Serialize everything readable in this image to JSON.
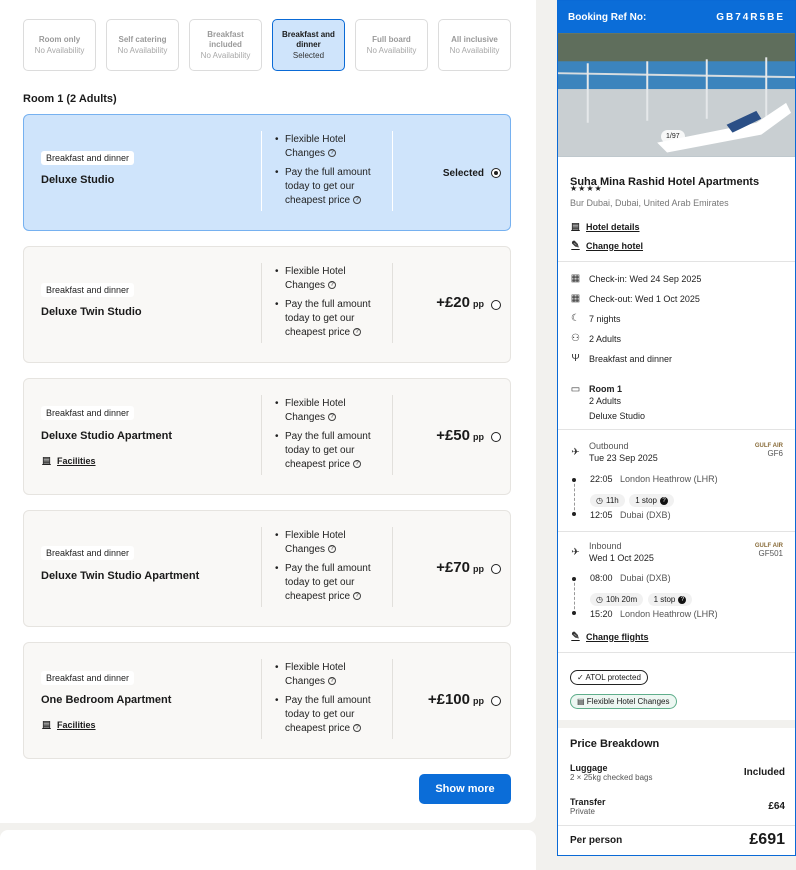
{
  "boards": [
    {
      "title": "Room only",
      "status": "No Availability",
      "selected": false
    },
    {
      "title": "Self catering",
      "status": "No Availability",
      "selected": false
    },
    {
      "title": "Breakfast included",
      "status": "No Availability",
      "selected": false
    },
    {
      "title": "Breakfast and dinner",
      "status": "Selected",
      "selected": true
    },
    {
      "title": "Full board",
      "status": "No Availability",
      "selected": false
    },
    {
      "title": "All inclusive",
      "status": "No Availability",
      "selected": false
    }
  ],
  "room_title": "Room 1 (2 Adults)",
  "rooms": [
    {
      "tag": "Breakfast and dinner",
      "name": "Deluxe Studio",
      "facilities": "",
      "price": "",
      "pp": "",
      "selected_label": "Selected",
      "bullet1": "Flexible Hotel Changes",
      "bullet2": "Pay the full amount today to get our cheapest price"
    },
    {
      "tag": "Breakfast and dinner",
      "name": "Deluxe Twin Studio",
      "facilities": "",
      "price": "+£20",
      "pp": "pp",
      "bullet1": "Flexible Hotel Changes",
      "bullet2": "Pay the full amount today to get our cheapest price"
    },
    {
      "tag": "Breakfast and dinner",
      "name": "Deluxe Studio Apartment",
      "facilities": "Facilities",
      "price": "+£50",
      "pp": "pp",
      "bullet1": "Flexible Hotel Changes",
      "bullet2": "Pay the full amount today to get our cheapest price"
    },
    {
      "tag": "Breakfast and dinner",
      "name": "Deluxe Twin Studio Apartment",
      "facilities": "",
      "price": "+£70",
      "pp": "pp",
      "bullet1": "Flexible Hotel Changes",
      "bullet2": "Pay the full amount today to get our cheapest price"
    },
    {
      "tag": "Breakfast and dinner",
      "name": "One Bedroom Apartment",
      "facilities": "Facilities",
      "price": "+£100",
      "pp": "pp",
      "bullet1": "Flexible Hotel Changes",
      "bullet2": "Pay the full amount today to get our cheapest price"
    }
  ],
  "show_more": "Show more",
  "booking": {
    "ref_label": "Booking Ref No:",
    "ref": "GB74R5BE",
    "image_count": "1/97",
    "hotel_name": "Suha Mina Rashid Hotel Apartments",
    "stars": "★★★★",
    "location": "Bur Dubai, Dubai, United Arab Emirates",
    "hotel_details": "Hotel details",
    "change_hotel": "Change hotel",
    "checkin": "Check-in: Wed 24 Sep 2025",
    "checkout": "Check-out: Wed 1 Oct 2025",
    "nights": "7 nights",
    "adults": "2 Adults",
    "board": "Breakfast and dinner",
    "room_label": "Room 1",
    "room_adults": "2 Adults",
    "room_name": "Deluxe Studio",
    "outbound": {
      "label": "Outbound",
      "date": "Tue 23 Sep 2025",
      "airline": "GULF AIR",
      "code": "GF6",
      "dep_time": "22:05",
      "dep_airport": "London Heathrow (LHR)",
      "duration": "11h",
      "stops": "1 stop",
      "arr_time": "12:05",
      "arr_airport": "Dubai (DXB)"
    },
    "inbound": {
      "label": "Inbound",
      "date": "Wed 1 Oct 2025",
      "airline": "GULF AIR",
      "code": "GF501",
      "dep_time": "08:00",
      "dep_airport": "Dubai (DXB)",
      "duration": "10h 20m",
      "stops": "1 stop",
      "arr_time": "15:20",
      "arr_airport": "London Heathrow (LHR)"
    },
    "change_flights": "Change flights",
    "atol": "ATOL protected",
    "flex": "Flexible Hotel Changes",
    "price_breakdown": "Price Breakdown",
    "luggage_label": "Luggage",
    "luggage_desc": "2 × 25kg checked bags",
    "luggage_value": "Included",
    "transfer_label": "Transfer",
    "transfer_desc": "Private",
    "transfer_value": "£64",
    "per_person_label": "Per person",
    "per_person_value": "£691"
  },
  "colors": {
    "accent": "#0b6dd8",
    "selected_bg": "#cfe4fb"
  }
}
